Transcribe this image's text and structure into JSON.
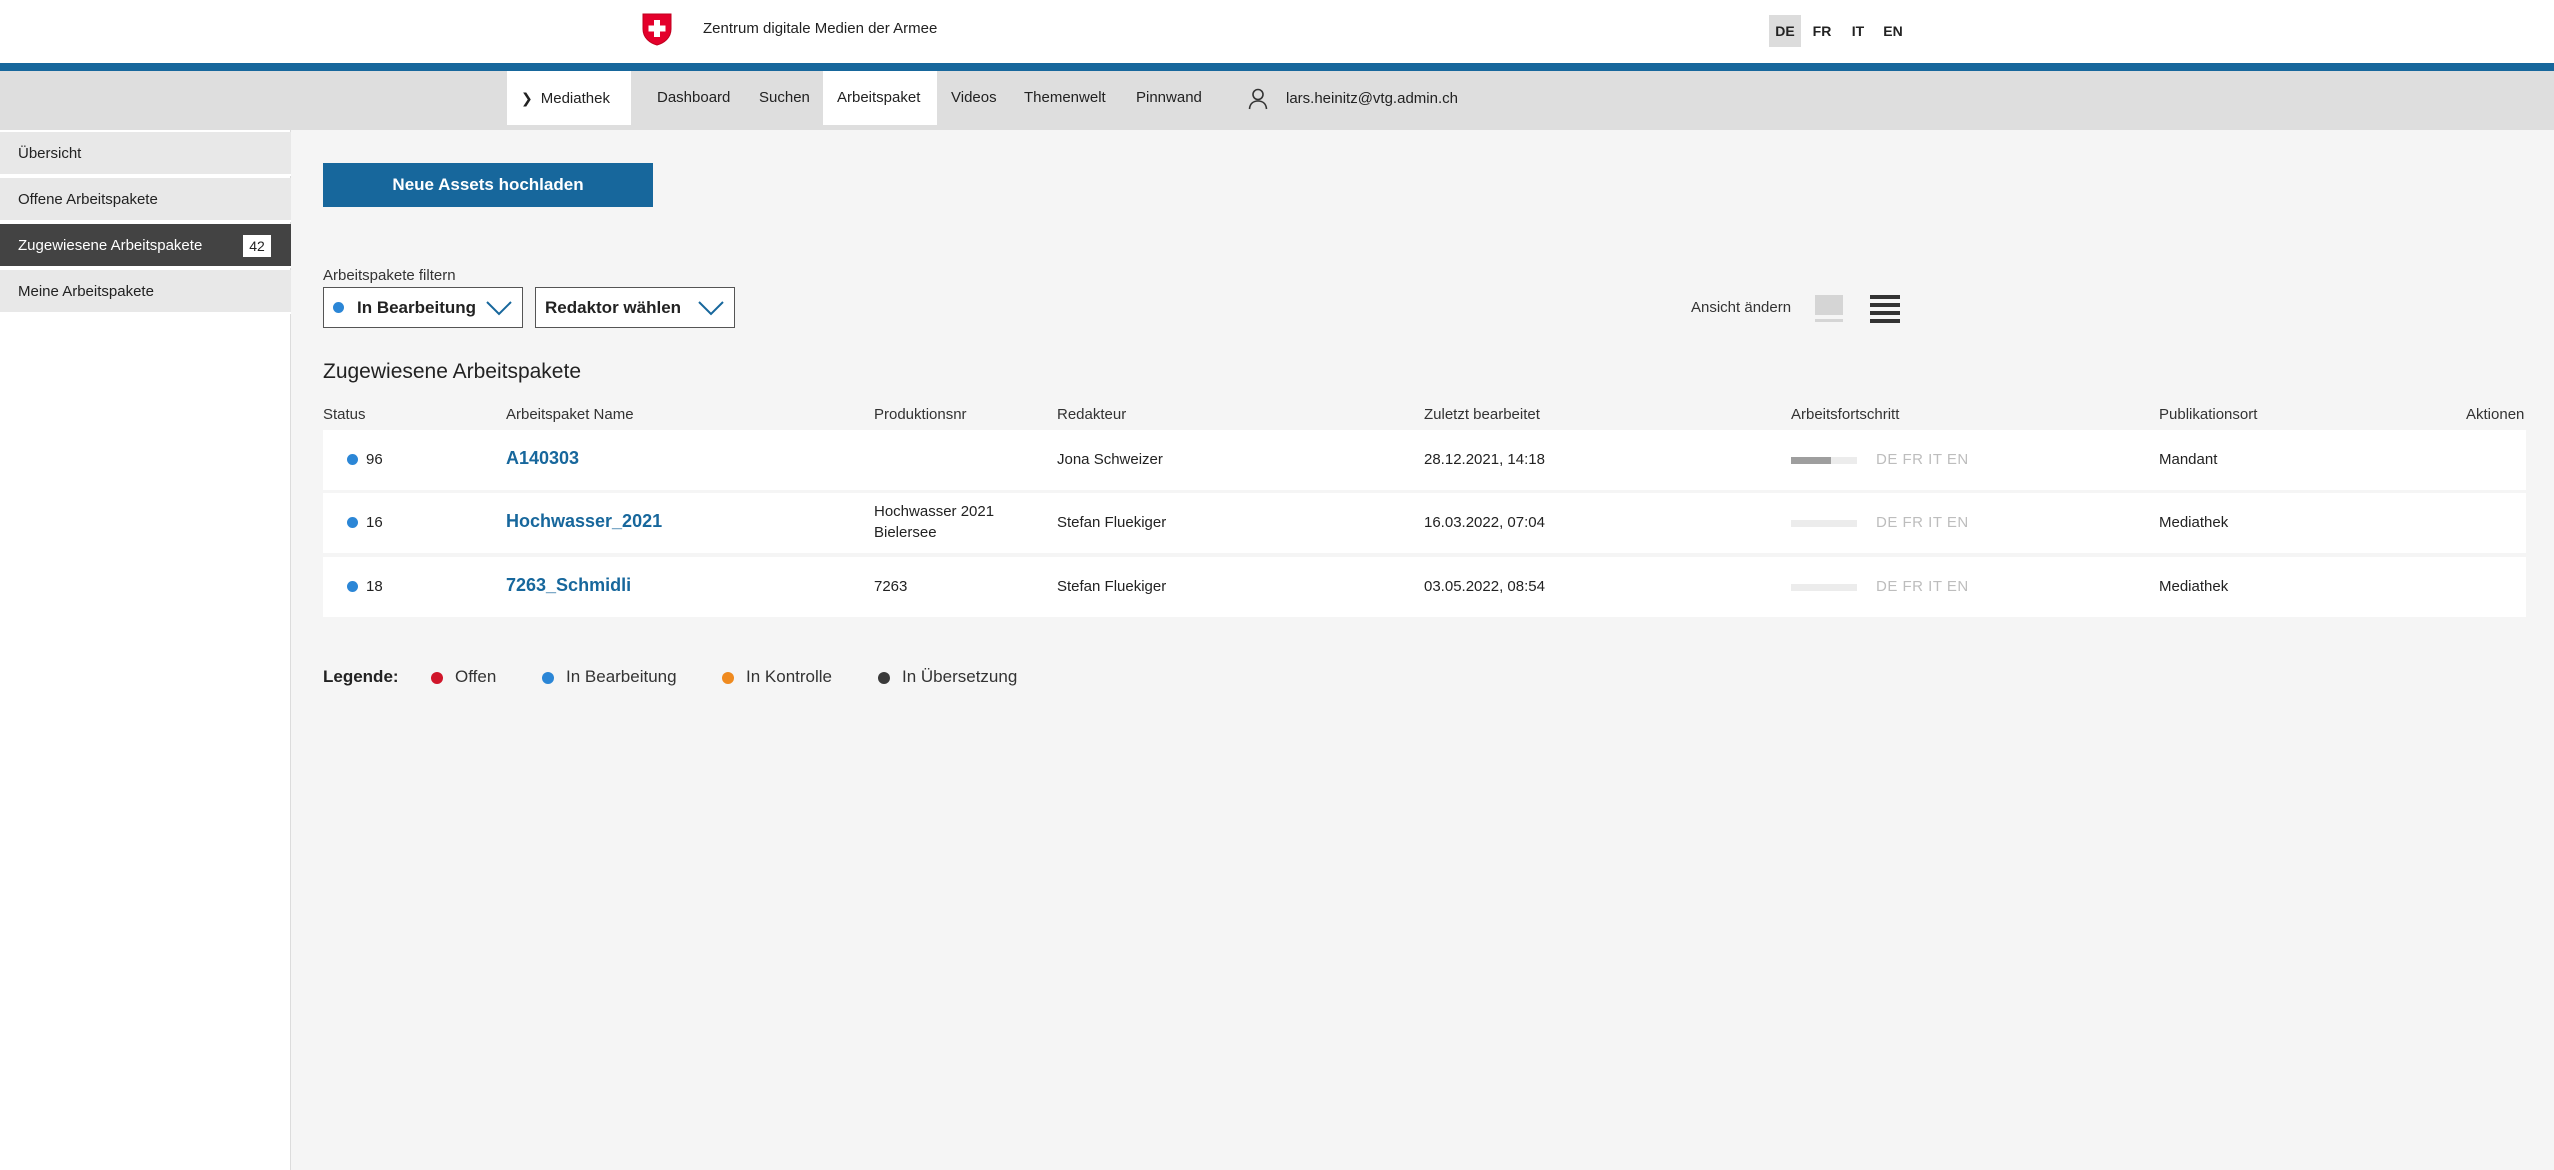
{
  "header": {
    "org_name": "Zentrum digitale Medien der Armee",
    "languages": [
      "DE",
      "FR",
      "IT",
      "EN"
    ],
    "active_language": "DE",
    "brand_color": "#17679c"
  },
  "nav": {
    "items": [
      "Mediathek",
      "Dashboard",
      "Suchen",
      "Arbeitspaket",
      "Videos",
      "Themenwelt",
      "Pinnwand"
    ],
    "active": "Arbeitspaket",
    "user_email": "lars.heinitz@vtg.admin.ch",
    "user_icon": "user-icon"
  },
  "sidebar": {
    "items": [
      {
        "label": "Übersicht"
      },
      {
        "label": "Offene Arbeitspakete"
      },
      {
        "label": "Zugewiesene Arbeitspakete",
        "badge": "42"
      },
      {
        "label": "Meine Arbeitspakete"
      }
    ],
    "active_index": 2
  },
  "main": {
    "upload_button": "Neue Assets hochladen",
    "filter_label": "Arbeitspakete filtern",
    "status_filter": "In Bearbeitung",
    "editor_filter": "Redaktor wählen",
    "view_label": "Ansicht ändern",
    "section_title": "Zugewiesene Arbeitspakete"
  },
  "table": {
    "headers": [
      "Status",
      "Arbeitspaket Name",
      "Produktionsnr",
      "Redakteur",
      "Zuletzt bearbeitet",
      "Arbeitsfortschritt",
      "Publikationsort",
      "Aktionen"
    ],
    "rows": [
      {
        "status": "96",
        "name": "A140303",
        "prod_line1": "",
        "prod_line2": "",
        "editor": "Jona Schweizer",
        "edited": "28.12.2021, 14:18",
        "progress": 0.6,
        "langs": "DE FR IT EN",
        "pub": "Mandant"
      },
      {
        "status": "16",
        "name": "Hochwasser_2021",
        "prod_line1": "Hochwasser 2021",
        "prod_line2": "Bielersee",
        "editor": "Stefan Fluekiger",
        "edited": "16.03.2022, 07:04",
        "progress": 0.0,
        "langs": "DE FR IT EN",
        "pub": "Mediathek"
      },
      {
        "status": "18",
        "name": "7263_Schmidli",
        "prod_line1": "7263",
        "prod_line2": "",
        "editor": "Stefan Fluekiger",
        "edited": "03.05.2022, 08:54",
        "progress": 0.0,
        "langs": "DE FR IT EN",
        "pub": "Mediathek"
      }
    ]
  },
  "legend": {
    "title": "Legende:",
    "items": [
      {
        "label": "Offen",
        "color": "#d0152a"
      },
      {
        "label": "In Bearbeitung",
        "color": "#2b86d6"
      },
      {
        "label": "In Kontrolle",
        "color": "#ef8a1f"
      },
      {
        "label": "In Übersetzung",
        "color": "#3a3a3a"
      }
    ]
  }
}
